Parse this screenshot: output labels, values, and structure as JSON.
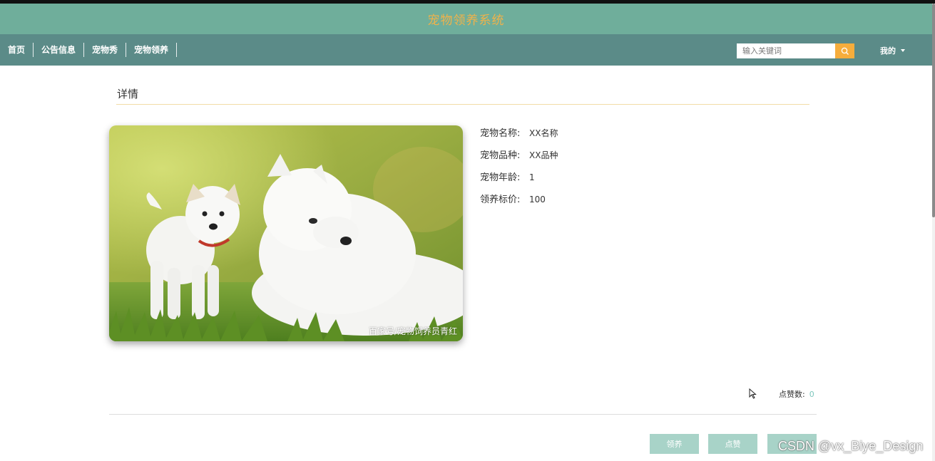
{
  "header": {
    "site_title": "宠物领养系统"
  },
  "nav": {
    "items": [
      {
        "label": "首页"
      },
      {
        "label": "公告信息"
      },
      {
        "label": "宠物秀"
      },
      {
        "label": "宠物领养"
      }
    ],
    "search_placeholder": "输入关键词",
    "user_menu_label": "我的"
  },
  "detail": {
    "section_title": "详情",
    "photo_caption": "百家号/宠物饲养员青红",
    "fields": [
      {
        "label": "宠物名称:",
        "value": "XX名称"
      },
      {
        "label": "宠物品种:",
        "value": "XX品种"
      },
      {
        "label": "宠物年龄:",
        "value": "1"
      },
      {
        "label": "领养标价:",
        "value": "100"
      }
    ],
    "likes_label": "点赞数:",
    "likes_count": "0"
  },
  "actions": {
    "adopt_label": "领养",
    "like_label": "点赞",
    "third_label": ""
  },
  "watermark": "CSDN @vx_Biye_Design",
  "colors": {
    "title_bar": "#6fae9b",
    "nav_bar": "#5b8b88",
    "accent_orange": "#f6ad3c",
    "button": "#a8d3c8",
    "likes_count": "#7ec7bd"
  },
  "icons": [
    "search-icon",
    "caret-down-icon",
    "mouse-cursor-icon"
  ]
}
